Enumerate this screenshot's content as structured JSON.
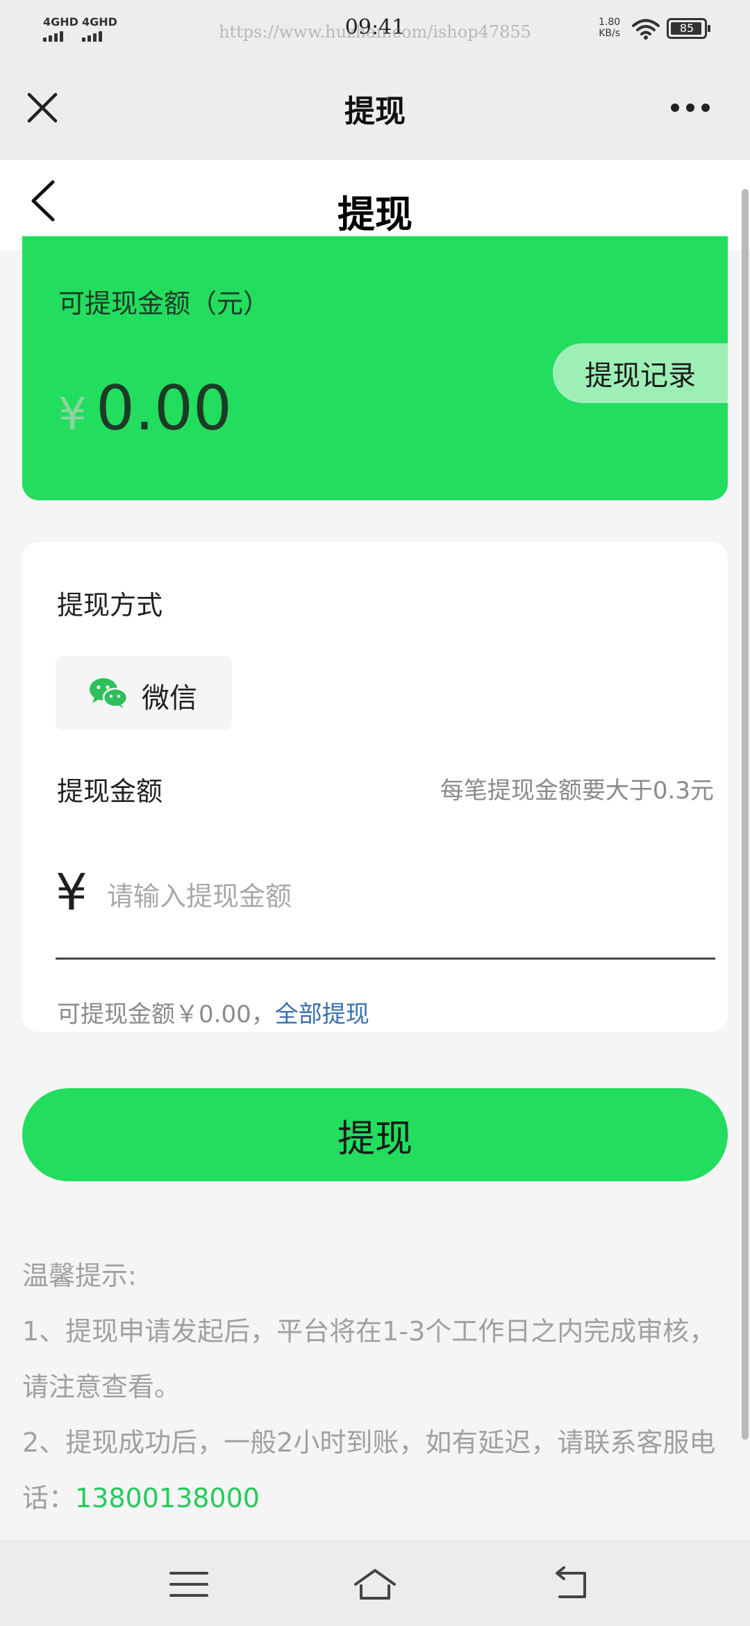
{
  "status_bar": {
    "signal_1": "4GHD",
    "signal_2": "4GHD",
    "time": "09:41",
    "watermark": "https://www.huzhan.com/ishop47855",
    "net_speed_value": "1.80",
    "net_speed_unit": "KB/s",
    "battery": "85"
  },
  "app_bar": {
    "title": "提现"
  },
  "page": {
    "title": "提现"
  },
  "balance": {
    "label": "可提现金额（元）",
    "currency": "¥",
    "amount": "0.00",
    "record_button": "提现记录"
  },
  "form": {
    "method_label": "提现方式",
    "method_name": "微信",
    "amount_label": "提现金额",
    "amount_tip": "每笔提现金额要大于0.3元",
    "currency": "¥",
    "amount_placeholder": "请输入提现金额",
    "available_text": "可提现金额￥0.00，",
    "withdraw_all": "全部提现"
  },
  "submit_button": "提现",
  "notice": {
    "title": "温馨提示:",
    "line1": "1、提现申请发起后，平台将在1-3个工作日之内完成审核，请注意查看。",
    "line2": "2、提现成功后，一般2小时到账，如有延迟，请联系客服电话：",
    "phone": "13800138000"
  },
  "colors": {
    "accent": "#22dd5e",
    "record_button_bg": "#9eefb6",
    "link": "#3a6fb0"
  }
}
